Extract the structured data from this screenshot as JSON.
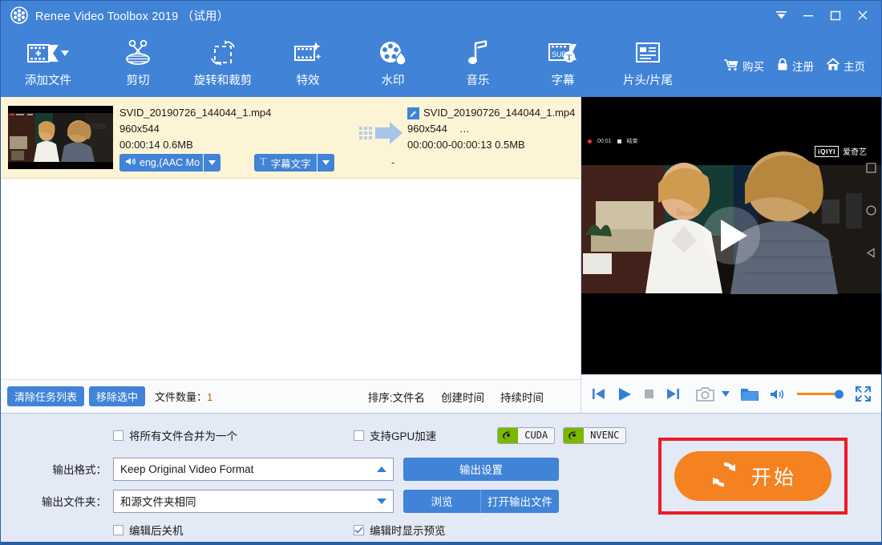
{
  "window": {
    "title": "Renee Video Toolbox 2019 （试用）",
    "logo_icon": "film-reel-icon",
    "controls": [
      {
        "name": "collapse-button",
        "icon": "collapse-icon"
      },
      {
        "name": "minimize-button",
        "icon": "minimize-icon"
      },
      {
        "name": "maximize-button",
        "icon": "maximize-icon"
      },
      {
        "name": "close-button",
        "icon": "close-icon"
      }
    ]
  },
  "toolbar": {
    "items": [
      {
        "label": "添加文件",
        "icon": "add-file-icon",
        "has_dropdown": true
      },
      {
        "label": "剪切",
        "icon": "scissors-icon",
        "has_dropdown": false
      },
      {
        "label": "旋转和裁剪",
        "icon": "rotate-crop-icon",
        "has_dropdown": false
      },
      {
        "label": "特效",
        "icon": "effects-icon",
        "has_dropdown": false
      },
      {
        "label": "水印",
        "icon": "watermark-icon",
        "has_dropdown": false
      },
      {
        "label": "音乐",
        "icon": "music-note-icon",
        "has_dropdown": false
      },
      {
        "label": "字幕",
        "icon": "subtitle-icon",
        "has_dropdown": false
      },
      {
        "label": "片头/片尾",
        "icon": "intro-outro-icon",
        "has_dropdown": false
      }
    ],
    "right_items": [
      {
        "label": "购买",
        "icon": "cart-icon"
      },
      {
        "label": "注册",
        "icon": "lock-icon"
      },
      {
        "label": "主页",
        "icon": "home-icon"
      }
    ]
  },
  "file_list": {
    "rows": [
      {
        "thumbnail_icon": "video-thumbnail",
        "source": {
          "filename": "SVID_20190726_144044_1.mp4",
          "resolution": "960x544",
          "duration_size": "00:00:14  0.6MB"
        },
        "output": {
          "edit_icon": "edit-pencil-icon",
          "filename": "SVID_20190726_144044_1.mp4",
          "resolution": "960x544",
          "resolution_more": "…",
          "duration_size": "00:00:00-00:00:13  0.5MB",
          "extra": "-"
        },
        "arrow_icon": "arrow-right-icon",
        "audio_track": {
          "icon": "speaker-icon",
          "label": "eng,(AAC Mo",
          "dropdown_icon": "chevron-down-icon"
        },
        "subtitle_track": {
          "icon": "text-t-icon",
          "label": "字幕文字",
          "dropdown_icon": "chevron-down-icon"
        }
      }
    ]
  },
  "list_bar": {
    "clear_list_label": "清除任务列表",
    "remove_selected_label": "移除选中",
    "count_label": "文件数量：",
    "count_value": "1",
    "sort_prefix": "排序:",
    "sort_options": [
      "文件名",
      "创建时间",
      "持续时间"
    ]
  },
  "preview": {
    "overlay_time": "00:01",
    "overlay_text": "结束",
    "play_icon": "play-button-icon",
    "watermark_brand": "iQIYI",
    "watermark_cn": "爱奇艺",
    "edge_icons": [
      "square-icon",
      "circle-icon",
      "triangle-left-icon"
    ],
    "controls": [
      {
        "name": "previous-button",
        "icon": "skip-previous-icon"
      },
      {
        "name": "play-button",
        "icon": "play-icon"
      },
      {
        "name": "stop-button",
        "icon": "stop-icon"
      },
      {
        "name": "next-button",
        "icon": "skip-next-icon"
      },
      {
        "name": "snapshot-button",
        "icon": "camera-icon"
      },
      {
        "name": "snapshot-dropdown",
        "icon": "chevron-down-icon"
      },
      {
        "name": "open-folder-button",
        "icon": "folder-icon"
      },
      {
        "name": "volume-button",
        "icon": "speaker-icon"
      },
      {
        "name": "fullscreen-button",
        "icon": "fullscreen-icon"
      }
    ],
    "volume_value": 100
  },
  "settings": {
    "merge_all_label": "将所有文件合并为一个",
    "merge_all_checked": false,
    "gpu_label": "支持GPU加速",
    "gpu_checked": false,
    "badges": [
      {
        "name": "cuda-badge",
        "label": "CUDA",
        "icon": "nvidia-icon"
      },
      {
        "name": "nvenc-badge",
        "label": "NVENC",
        "icon": "nvidia-icon"
      }
    ],
    "format_label": "输出格式：",
    "format_value": "Keep Original Video Format",
    "format_caret": "caret-up-icon",
    "output_settings_label": "输出设置",
    "folder_label": "输出文件夹：",
    "folder_value": "和源文件夹相同",
    "folder_caret": "caret-down-icon",
    "browse_label": "浏览",
    "open_output_label": "打开输出文件",
    "shutdown_label": "编辑后关机",
    "shutdown_checked": false,
    "preview_label": "编辑时显示预览",
    "preview_checked": true,
    "start_label": "开始",
    "start_icon": "refresh-circle-icon",
    "highlight_color": "#ec1c24",
    "start_color": "#f58220"
  },
  "theme": {
    "primary_blue": "#4183d7",
    "panel_bg": "#e3e9f5",
    "row_highlight": "#fdf4d5",
    "orange": "#f58220"
  }
}
